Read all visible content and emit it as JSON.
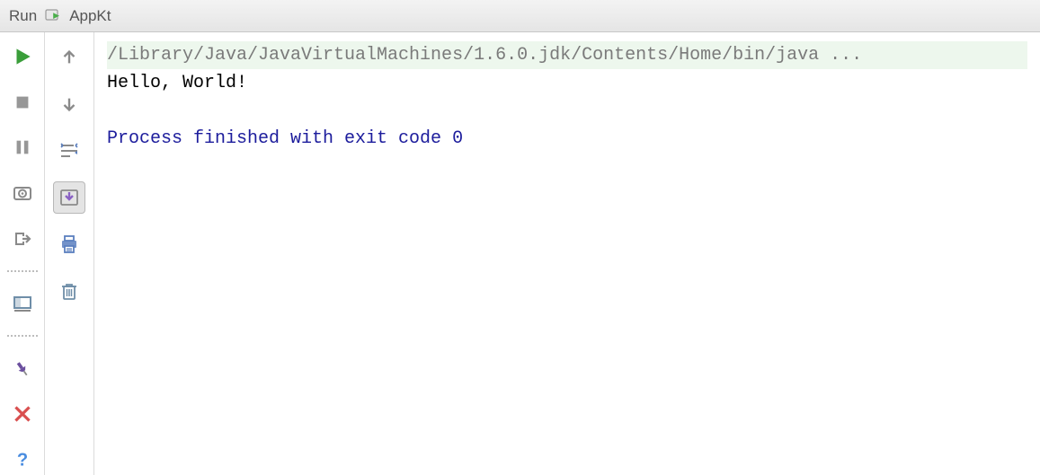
{
  "header": {
    "label": "Run",
    "run_config": "AppKt"
  },
  "toolbar_primary": {
    "run": "run-icon",
    "stop": "stop-icon",
    "pause": "pause-icon",
    "dump": "dump-threads-icon",
    "exit": "exit-icon",
    "layout": "layout-icon",
    "pin": "pin-icon",
    "close": "close-icon",
    "help": "help-icon"
  },
  "toolbar_secondary": {
    "up": "arrow-up-icon",
    "down": "arrow-down-icon",
    "soft_wrap": "soft-wrap-icon",
    "scroll_end": "scroll-to-end-icon",
    "print": "print-icon",
    "clear": "clear-all-icon"
  },
  "console": {
    "command": "/Library/Java/JavaVirtualMachines/1.6.0.jdk/Contents/Home/bin/java ...",
    "output": "Hello, World!",
    "blank": "",
    "exit": "Process finished with exit code 0"
  },
  "colors": {
    "run_green": "#3a9e3a",
    "stop_gray": "#979797",
    "close_red": "#d94f4f",
    "help_blue": "#4a8de0",
    "pin_purple": "#6b4f9e"
  }
}
